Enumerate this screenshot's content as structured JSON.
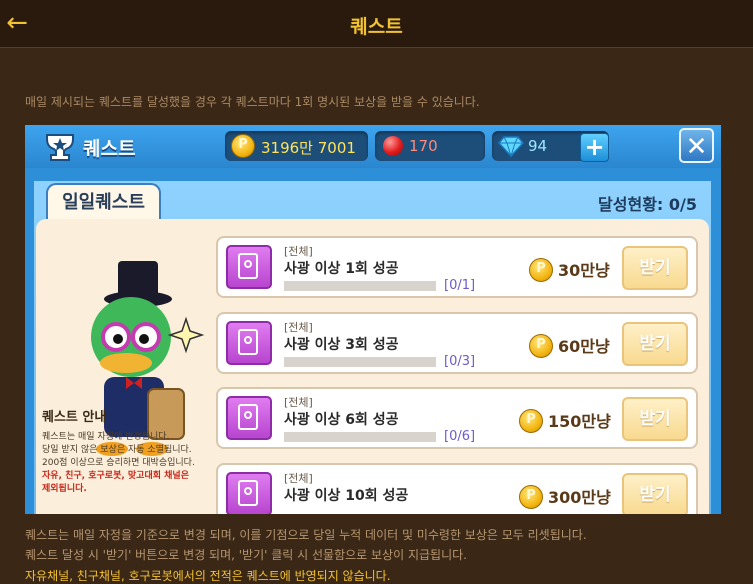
{
  "topbar": {
    "back_icon": "back-arrow-icon",
    "title": "퀘스트"
  },
  "intro": "매일 제시되는 퀘스트를 달성했을 경우 각 퀘스트마다 1회 명시된 보상을 받을 수 있습니다.",
  "game": {
    "title": "퀘스트",
    "currency": {
      "gold": "3196만 7001",
      "ruby": "170",
      "diamond": "94"
    },
    "tab": "일일퀘스트",
    "progress": "달성현황: 0/5",
    "guide": {
      "title": "퀘스트 안내",
      "lines": [
        "퀘스트는 매일 자정에 변경됩니다.",
        "당일 받지 않은 보상은 자동 소멸됩니다.",
        "200점 이상으로 승리하면 대박승입니다.",
        "자유, 친구, 호구로봇, 맞고대회 채널은",
        "제외됩니다."
      ]
    },
    "quests": [
      {
        "tag": "[전체]",
        "name": "사광 이상 1회 성공",
        "count": "[0/1]",
        "reward": "30만냥",
        "button": "받기"
      },
      {
        "tag": "[전체]",
        "name": "사광 이상 3회 성공",
        "count": "[0/3]",
        "reward": "60만냥",
        "button": "받기"
      },
      {
        "tag": "[전체]",
        "name": "사광 이상 6회 성공",
        "count": "[0/6]",
        "reward": "150만냥",
        "button": "받기"
      },
      {
        "tag": "[전체]",
        "name": "사광 이상 10회 성공",
        "count": "",
        "reward": "300만냥",
        "button": "받기"
      }
    ]
  },
  "footer": [
    "퀘스트는 매일 자정을 기준으로 변경 되며, 이를 기점으로 당일 누적 데이터 및 미수령한 보상은 모두 리셋됩니다.",
    "퀘스트 달성 시 '받기' 버튼으로 변경 되며, '받기' 클릭 시 선물함으로 보상이 지급됩니다.",
    "자유채널, 친구채널, 호구로봇에서의 전적은 퀘스트에 반영되지 않습니다."
  ]
}
